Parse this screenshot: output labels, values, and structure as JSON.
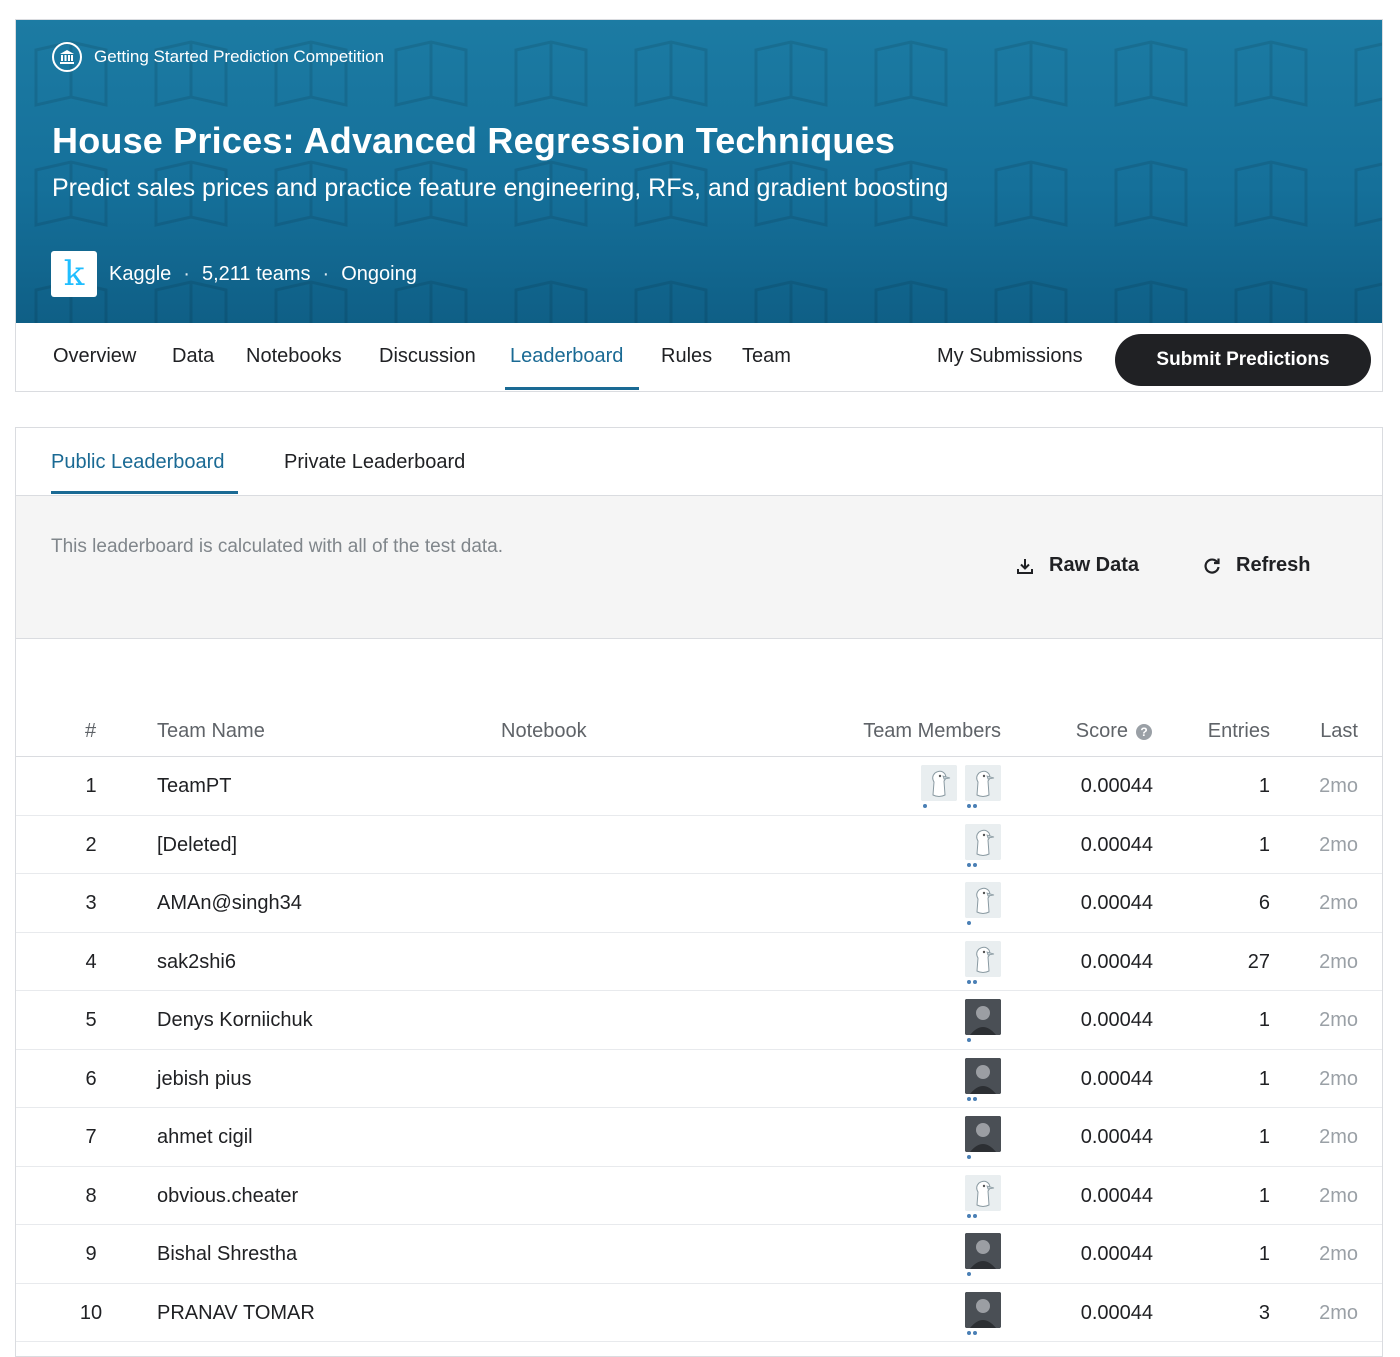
{
  "header": {
    "category": "Getting Started Prediction Competition",
    "title": "House Prices: Advanced Regression Techniques",
    "subtitle": "Predict sales prices and practice feature engineering, RFs, and gradient boosting",
    "host": "Kaggle",
    "logo_letter": "k",
    "separator": "·",
    "teams": "5,211 teams",
    "status": "Ongoing"
  },
  "nav": {
    "tabs": [
      "Overview",
      "Data",
      "Notebooks",
      "Discussion",
      "Leaderboard",
      "Rules",
      "Team"
    ],
    "active_tab": "Leaderboard",
    "my_submissions": "My Submissions",
    "submit_label": "Submit Predictions"
  },
  "leaderboard": {
    "tabs": [
      "Public Leaderboard",
      "Private Leaderboard"
    ],
    "active_tab": "Public Leaderboard",
    "info_text": "This leaderboard is calculated with all of the test data.",
    "raw_data_label": "Raw Data",
    "refresh_label": "Refresh",
    "columns": {
      "rank": "#",
      "team_name": "Team Name",
      "notebook": "Notebook",
      "team_members": "Team Members",
      "score": "Score",
      "entries": "Entries",
      "last": "Last"
    },
    "rows": [
      {
        "rank": "1",
        "team": "TeamPT",
        "members": [
          "default-avatar",
          "default-avatar"
        ],
        "score": "0.00044",
        "entries": "1",
        "last": "2mo"
      },
      {
        "rank": "2",
        "team": "[Deleted]",
        "members": [
          "default-avatar"
        ],
        "score": "0.00044",
        "entries": "1",
        "last": "2mo"
      },
      {
        "rank": "3",
        "team": "AMAn@singh34",
        "members": [
          "default-avatar"
        ],
        "score": "0.00044",
        "entries": "6",
        "last": "2mo"
      },
      {
        "rank": "4",
        "team": "sak2shi6",
        "members": [
          "default-avatar"
        ],
        "score": "0.00044",
        "entries": "27",
        "last": "2mo"
      },
      {
        "rank": "5",
        "team": "Denys Korniichuk",
        "members": [
          "photo-avatar"
        ],
        "score": "0.00044",
        "entries": "1",
        "last": "2mo"
      },
      {
        "rank": "6",
        "team": "jebish pius",
        "members": [
          "photo-avatar"
        ],
        "score": "0.00044",
        "entries": "1",
        "last": "2mo"
      },
      {
        "rank": "7",
        "team": "ahmet cigil",
        "members": [
          "photo-avatar"
        ],
        "score": "0.00044",
        "entries": "1",
        "last": "2mo"
      },
      {
        "rank": "8",
        "team": "obvious.cheater",
        "members": [
          "default-avatar"
        ],
        "score": "0.00044",
        "entries": "1",
        "last": "2mo"
      },
      {
        "rank": "9",
        "team": "Bishal Shrestha",
        "members": [
          "photo-avatar"
        ],
        "score": "0.00044",
        "entries": "1",
        "last": "2mo"
      },
      {
        "rank": "10",
        "team": "PRANAV TOMAR",
        "members": [
          "photo-avatar"
        ],
        "score": "0.00044",
        "entries": "3",
        "last": "2mo"
      }
    ]
  },
  "colors": {
    "banner": "#15709a",
    "accent": "#1a6a94",
    "button_dark": "#202124",
    "muted": "#9aa0a6"
  },
  "icons": {
    "category": "bank-institution-icon",
    "raw_data": "download-icon",
    "refresh": "refresh-icon",
    "score_help": "help-circle-icon"
  }
}
